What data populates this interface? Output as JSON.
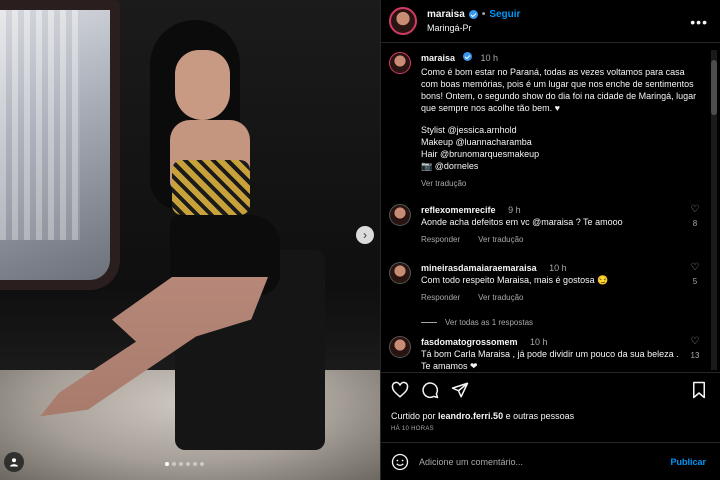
{
  "header": {
    "username": "maraisa",
    "separator": "•",
    "follow_label": "Seguir",
    "location": "Maringá-Pr",
    "more_icon": "more-horizontal-icon"
  },
  "caption": {
    "username": "maraisa",
    "time": "10 h",
    "text": "Como é bom estar no Paraná, todas as vezes voltamos para casa com boas memórias, pois é um lugar que nos enche de sentimentos bons! Ontem, o segundo show do dia foi na cidade de Maringá, lugar que sempre nos acolhe tão bem. ♥",
    "credits": [
      "Stylist @jessica.arnhold",
      "Makeup @luannacharamba",
      "Hair @brunomarquesmakeup",
      "📷 @dorneles"
    ],
    "translate_label": "Ver tradução"
  },
  "comments": [
    {
      "username": "reflexomemrecife",
      "time": "9 h",
      "text": "Aonde acha defeitos em vc @maraisa ? Te amooo",
      "reply_label": "Responder",
      "translate_label": "Ver tradução",
      "likes": "8"
    },
    {
      "username": "mineirasdamaiaraemaraisa",
      "time": "10 h",
      "text": "Com todo respeito Maraisa, mais é gostosa 😏",
      "reply_label": "Responder",
      "translate_label": "Ver tradução",
      "likes": "5"
    },
    {
      "username": "fasdomatogrossomem",
      "time": "10 h",
      "text": "Tá bom Carla Maraisa , já pode dividir um pouco da sua beleza . Te amamos ❤",
      "likes": "13"
    }
  ],
  "view_replies_label": "Ver todas as 1 respostas",
  "actions": {
    "liked_prefix": "Curtido por",
    "liked_user": "leandro.ferri.50",
    "liked_suffix": "e outras pessoas",
    "post_time": "HÁ 10 HORAS"
  },
  "add_comment": {
    "placeholder": "Adicione um comentário...",
    "publish_label": "Publicar"
  },
  "carousel": {
    "slide_count": 6,
    "active_index": 0
  },
  "colors": {
    "accent": "#0095f6",
    "verified": "#3797f0",
    "like_red": "#ed4956",
    "muted": "#a8a8a8"
  }
}
